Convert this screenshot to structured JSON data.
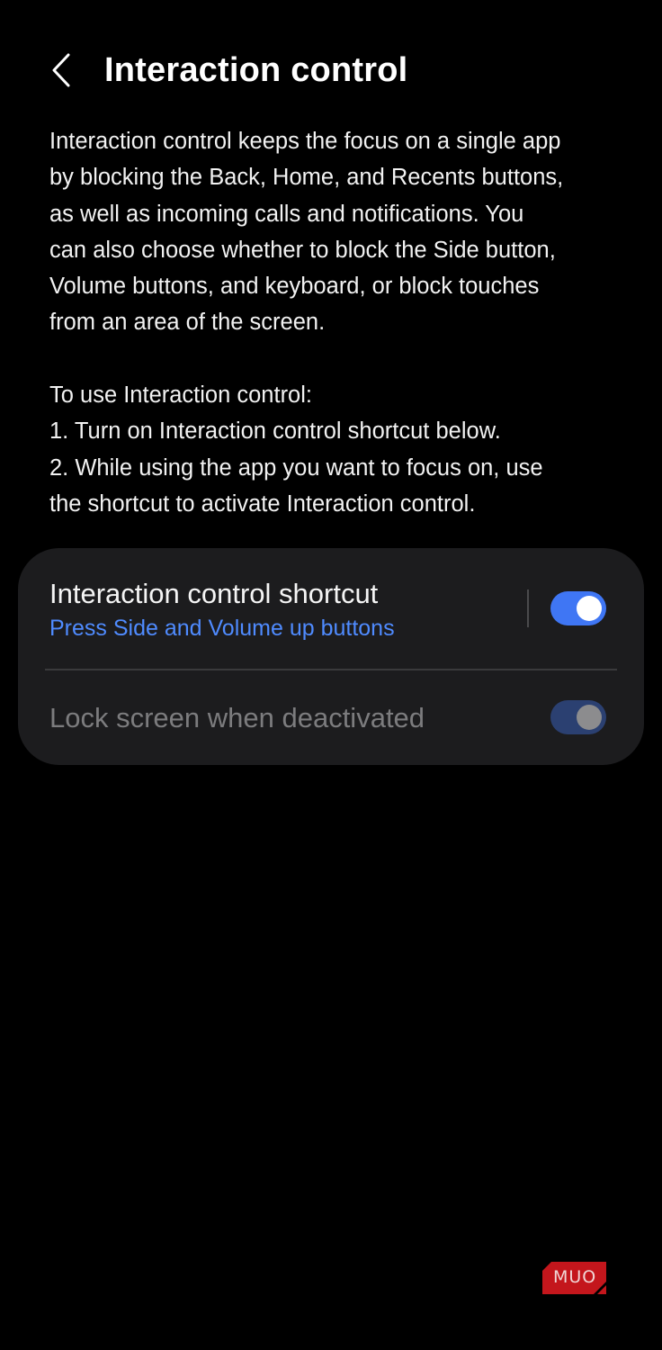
{
  "header": {
    "back_icon": "chevron-left-icon",
    "title": "Interaction control"
  },
  "description": {
    "lines": [
      "Interaction control keeps the focus on a single app",
      "by blocking the Back, Home, and Recents buttons,",
      "as well as incoming calls and notifications. You",
      "can also choose whether to block the Side button,",
      "Volume buttons, and keyboard, or block touches",
      "from an area of the screen."
    ],
    "instructions": [
      "To use Interaction control:",
      "1. Turn on Interaction control shortcut below.",
      "2. While using the app you want to focus on, use",
      "the shortcut to activate Interaction control."
    ]
  },
  "settings": {
    "shortcut": {
      "title": "Interaction control shortcut",
      "subtitle": "Press Side and Volume up buttons",
      "enabled": true
    },
    "lock_screen": {
      "title": "Lock screen when deactivated",
      "enabled": true,
      "disabled_state": true
    }
  },
  "watermark": {
    "text": "MUO"
  },
  "colors": {
    "background": "#000000",
    "card": "#1c1c1e",
    "accent": "#3f76f4",
    "subtitle": "#4f8bff",
    "disabled_text": "#7c7c7e",
    "watermark_red": "#c4161c"
  }
}
